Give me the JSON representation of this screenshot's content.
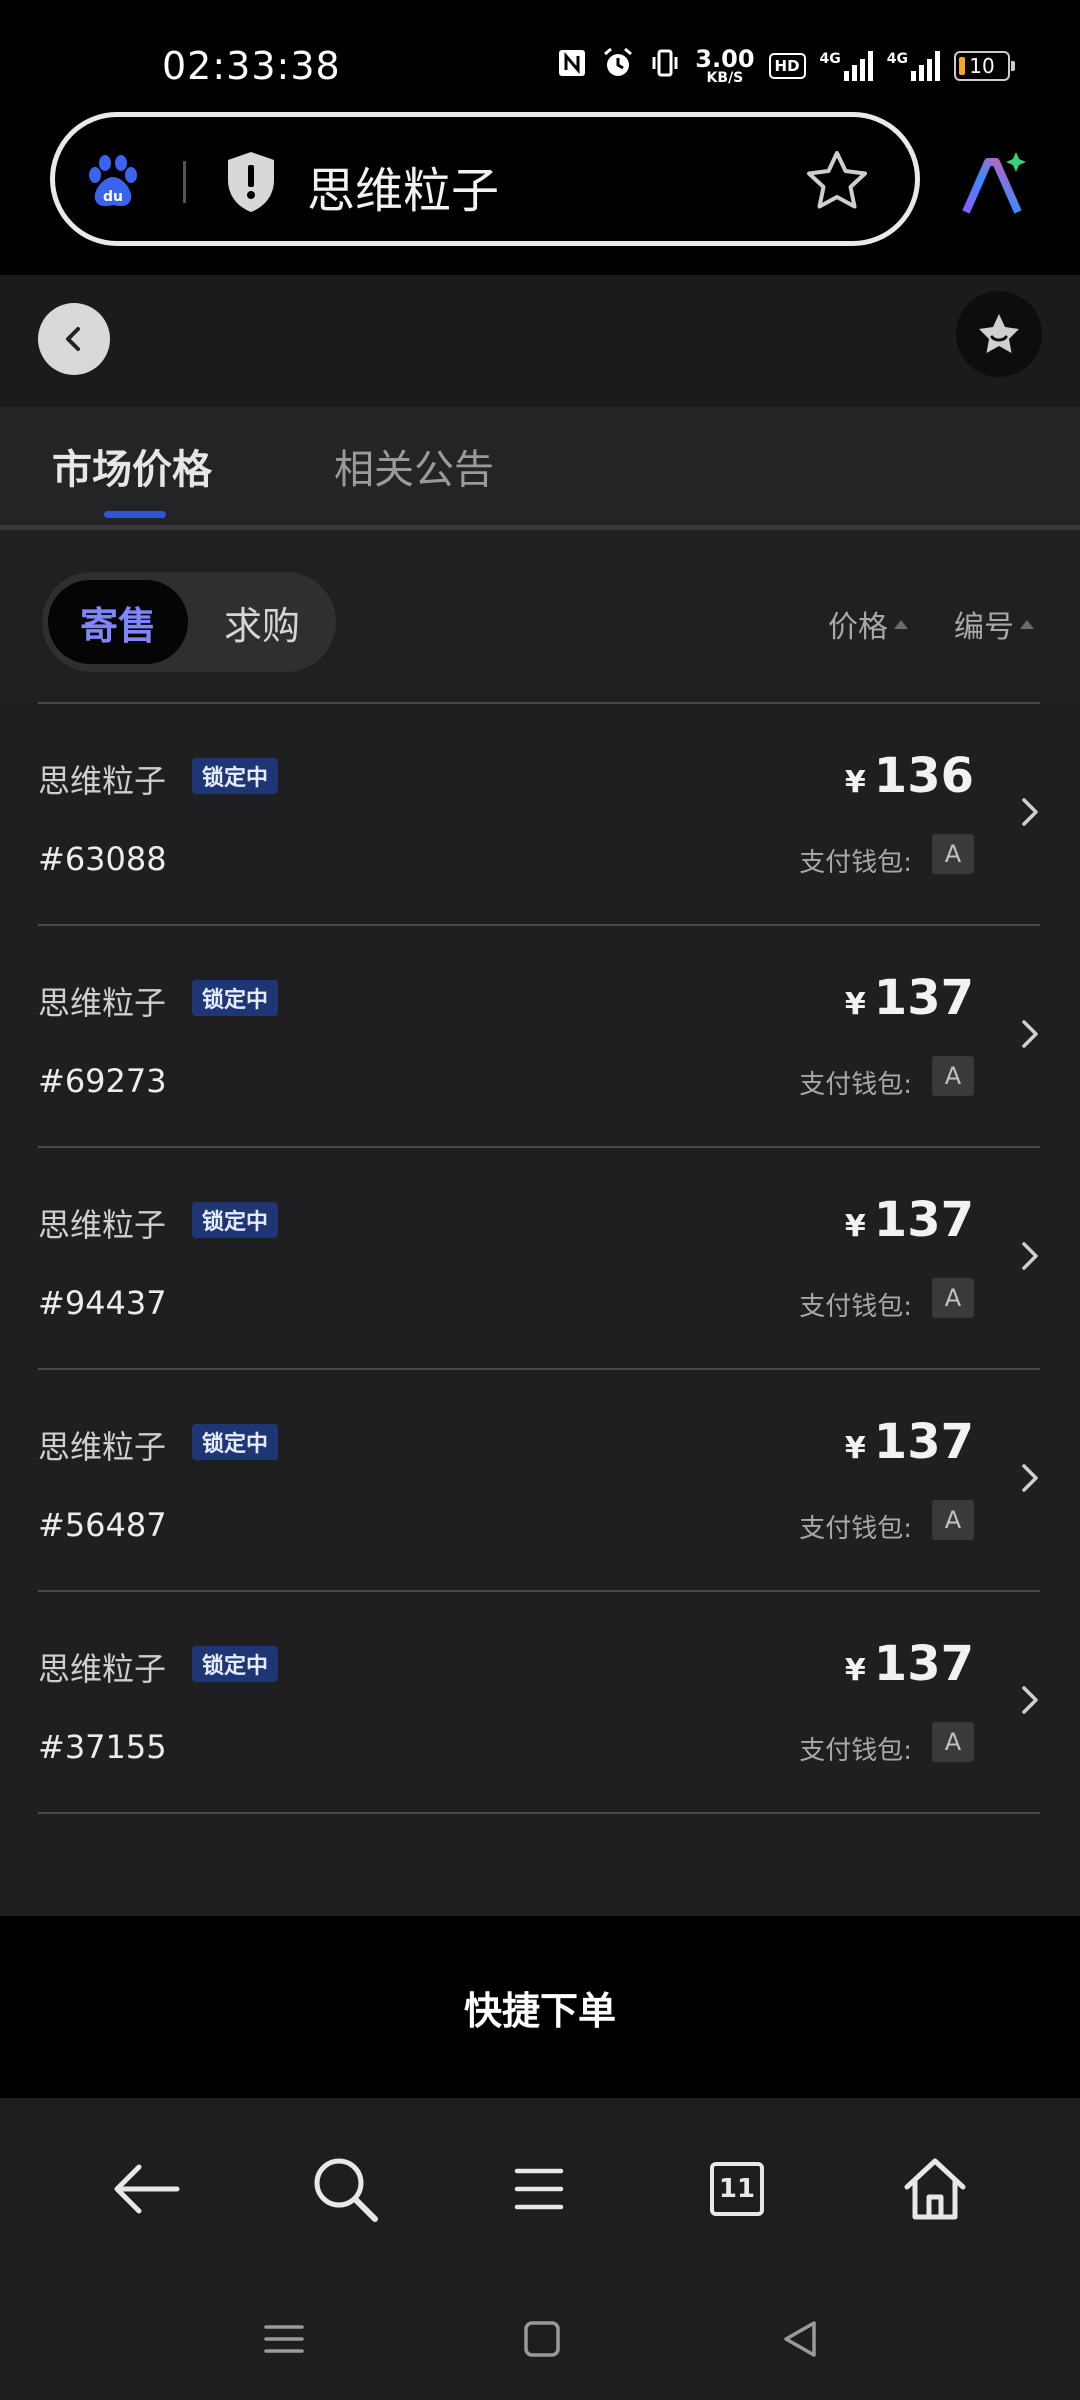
{
  "status_bar": {
    "time": "02:33:38",
    "net_speed_value": "3.00",
    "net_speed_unit": "KB/S",
    "hd_label": "HD",
    "signal_1_label": "4G",
    "signal_2_label": "4G",
    "battery_level": "10"
  },
  "browser": {
    "page_title": "思维粒子",
    "open_tabs_count": "11"
  },
  "tabs": [
    {
      "label": "市场价格",
      "active": true
    },
    {
      "label": "相关公告",
      "active": false
    }
  ],
  "segment": {
    "items": [
      {
        "label": "寄售",
        "active": true
      },
      {
        "label": "求购",
        "active": false
      }
    ]
  },
  "sort": {
    "price_label": "价格",
    "number_label": "编号"
  },
  "listings": [
    {
      "name": "思维粒子",
      "badge": "锁定中",
      "id": "#63088",
      "currency": "¥",
      "price": "136",
      "wallet_label": "支付钱包:",
      "wallet": "A"
    },
    {
      "name": "思维粒子",
      "badge": "锁定中",
      "id": "#69273",
      "currency": "¥",
      "price": "137",
      "wallet_label": "支付钱包:",
      "wallet": "A"
    },
    {
      "name": "思维粒子",
      "badge": "锁定中",
      "id": "#94437",
      "currency": "¥",
      "price": "137",
      "wallet_label": "支付钱包:",
      "wallet": "A"
    },
    {
      "name": "思维粒子",
      "badge": "锁定中",
      "id": "#56487",
      "currency": "¥",
      "price": "137",
      "wallet_label": "支付钱包:",
      "wallet": "A"
    },
    {
      "name": "思维粒子",
      "badge": "锁定中",
      "id": "#37155",
      "currency": "¥",
      "price": "137",
      "wallet_label": "支付钱包:",
      "wallet": "A"
    }
  ],
  "quick_order": {
    "label": "快捷下单"
  },
  "colors": {
    "accent": "#7f86ff",
    "badge_bg": "#1f3675",
    "tab_indicator": "#2f55d4",
    "background": "#1f1f21"
  }
}
